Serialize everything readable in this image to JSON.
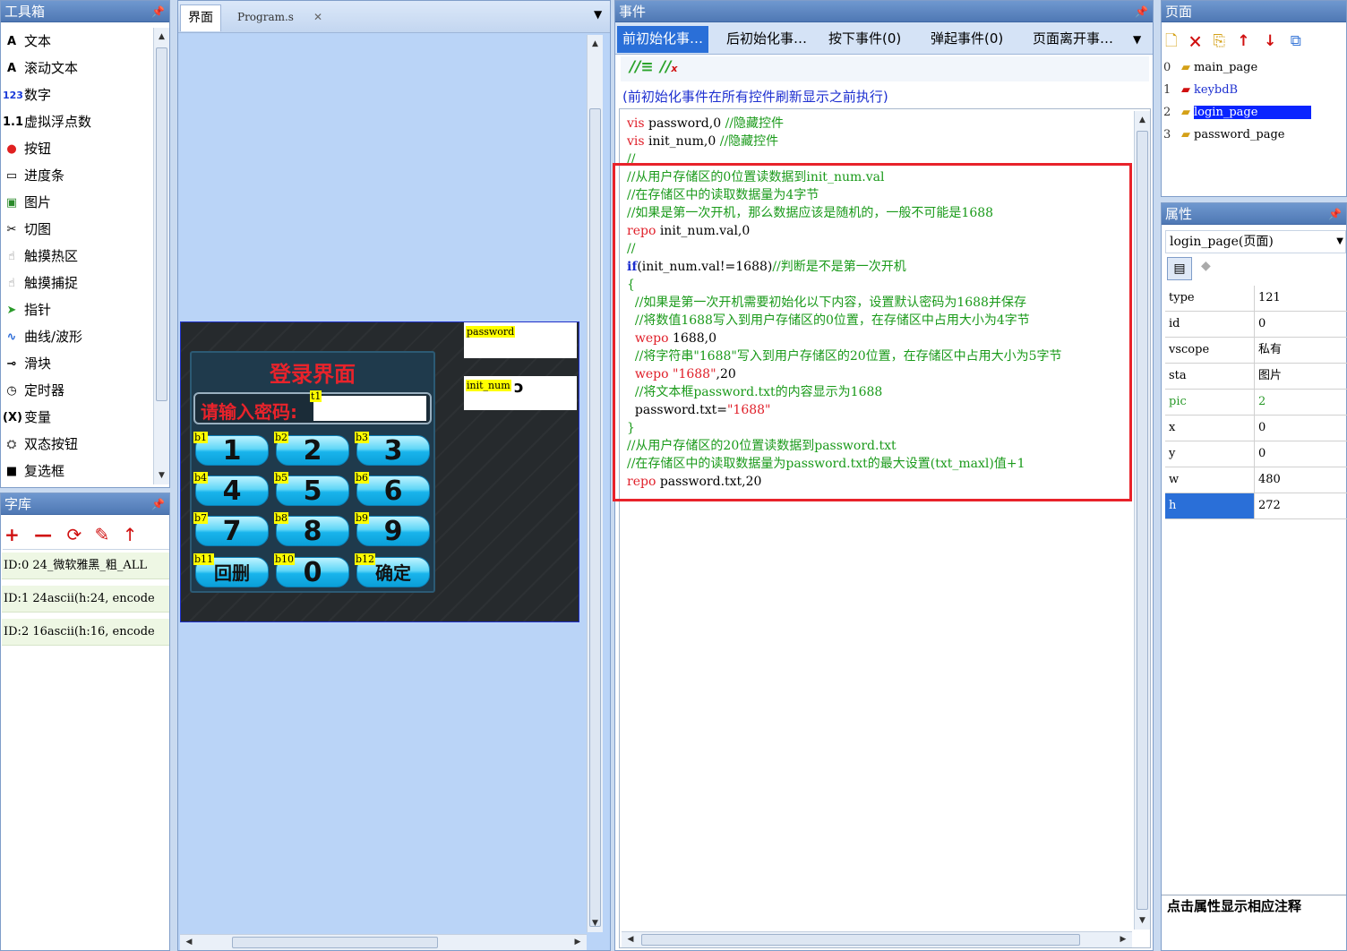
{
  "toolbox": {
    "title": "工具箱",
    "items": [
      {
        "label": "文本",
        "icon": "A"
      },
      {
        "label": "滚动文本",
        "icon": "A"
      },
      {
        "label": "数字",
        "icon": "123"
      },
      {
        "label": "虚拟浮点数",
        "icon": "1.1"
      },
      {
        "label": "按钮",
        "icon": "●"
      },
      {
        "label": "进度条",
        "icon": "▭"
      },
      {
        "label": "图片",
        "icon": "▣"
      },
      {
        "label": "切图",
        "icon": "✂"
      },
      {
        "label": "触摸热区",
        "icon": "☝"
      },
      {
        "label": "触摸捕捉",
        "icon": "☝"
      },
      {
        "label": "指针",
        "icon": "➤"
      },
      {
        "label": "曲线/波形",
        "icon": "∿"
      },
      {
        "label": "滑块",
        "icon": "⊸"
      },
      {
        "label": "定时器",
        "icon": "◷"
      },
      {
        "label": "变量",
        "icon": "(X)"
      },
      {
        "label": "双态按钮",
        "icon": "⛭"
      },
      {
        "label": "复选框",
        "icon": "■"
      }
    ]
  },
  "fontlib": {
    "title": "字库",
    "rows": [
      "ID:0   24_微软雅黑_粗_ALL",
      "ID:1   24ascii(h:24, encode",
      "ID:2   16ascii(h:16, encode"
    ]
  },
  "canvas": {
    "tabs": [
      "界面",
      "Program.s"
    ],
    "screen": {
      "title": "登录界面",
      "prompt": "请输入密码:",
      "tag_t1": "t1",
      "password_label": "password",
      "initnum_label": "init_num",
      "keys": [
        {
          "tag": "b1",
          "label": "1"
        },
        {
          "tag": "b2",
          "label": "2"
        },
        {
          "tag": "b3",
          "label": "3"
        },
        {
          "tag": "b4",
          "label": "4"
        },
        {
          "tag": "b5",
          "label": "5"
        },
        {
          "tag": "b6",
          "label": "6"
        },
        {
          "tag": "b7",
          "label": "7"
        },
        {
          "tag": "b8",
          "label": "8"
        },
        {
          "tag": "b9",
          "label": "9"
        },
        {
          "tag": "b11",
          "label": "回删"
        },
        {
          "tag": "b10",
          "label": "0"
        },
        {
          "tag": "b12",
          "label": "确定"
        }
      ]
    }
  },
  "events": {
    "title": "事件",
    "tabs": [
      "前初始化事…",
      "后初始化事…",
      "按下事件(0)",
      "弹起事件(0)",
      "页面离开事…"
    ],
    "description": "(前初始化事件在所有控件刷新显示之前执行)",
    "code": [
      [
        {
          "t": "kw",
          "s": "vis"
        },
        {
          "t": "n",
          "s": " password,0 "
        },
        {
          "t": "cm",
          "s": "//隐藏控件"
        }
      ],
      [
        {
          "t": "kw",
          "s": "vis"
        },
        {
          "t": "n",
          "s": " init_num,0 "
        },
        {
          "t": "cm",
          "s": "//隐藏控件"
        }
      ],
      [
        {
          "t": "cm",
          "s": "//"
        }
      ],
      [
        {
          "t": "cm",
          "s": "//从用户存储区的0位置读数据到init_num.val"
        }
      ],
      [
        {
          "t": "cm",
          "s": "//在存储区中的读取数据量为4字节"
        }
      ],
      [
        {
          "t": "cm",
          "s": "//如果是第一次开机，那么数据应该是随机的，一般不可能是1688"
        }
      ],
      [
        {
          "t": "kw",
          "s": "repo"
        },
        {
          "t": "n",
          "s": " init_num.val,0"
        }
      ],
      [
        {
          "t": "cm",
          "s": "//"
        }
      ],
      [
        {
          "t": "bl",
          "s": "if"
        },
        {
          "t": "n",
          "s": "(init_num.val!=1688)"
        },
        {
          "t": "cm",
          "s": "//判断是不是第一次开机"
        }
      ],
      [
        {
          "t": "cm",
          "s": "{"
        }
      ],
      [
        {
          "t": "cm",
          "s": "  //如果是第一次开机需要初始化以下内容，设置默认密码为1688并保存"
        }
      ],
      [
        {
          "t": "cm",
          "s": "  //将数值1688写入到用户存储区的0位置，在存储区中占用大小为4字节"
        }
      ],
      [
        {
          "t": "kw",
          "s": "  wepo"
        },
        {
          "t": "n",
          "s": " 1688,0"
        }
      ],
      [
        {
          "t": "cm",
          "s": "  //将字符串\"1688\"写入到用户存储区的20位置，在存储区中占用大小为5字节"
        }
      ],
      [
        {
          "t": "kw",
          "s": "  wepo"
        },
        {
          "t": "st",
          "s": " \"1688\""
        },
        {
          "t": "n",
          "s": ",20"
        }
      ],
      [
        {
          "t": "cm",
          "s": "  //将文本框password.txt的内容显示为1688"
        }
      ],
      [
        {
          "t": "n",
          "s": "  password.txt="
        },
        {
          "t": "st",
          "s": "\"1688\""
        }
      ],
      [
        {
          "t": "cm",
          "s": "}"
        }
      ],
      [
        {
          "t": "cm",
          "s": "//从用户存储区的20位置读数据到password.txt"
        }
      ],
      [
        {
          "t": "cm",
          "s": "//在存储区中的读取数据量为password.txt的最大设置(txt_maxl)值+1"
        }
      ],
      [
        {
          "t": "kw",
          "s": "repo"
        },
        {
          "t": "n",
          "s": " password.txt,20"
        }
      ]
    ]
  },
  "pages": {
    "title": "页面",
    "items": [
      {
        "index": "0",
        "name": "main_page"
      },
      {
        "index": "1",
        "name": "keybdB"
      },
      {
        "index": "2",
        "name": "login_page"
      },
      {
        "index": "3",
        "name": "password_page"
      }
    ],
    "selected_index": 2
  },
  "props": {
    "title": "属性",
    "selector": "login_page(页面)",
    "rows": [
      {
        "k": "type",
        "v": "121"
      },
      {
        "k": "id",
        "v": "0"
      },
      {
        "k": "vscope",
        "v": "私有"
      },
      {
        "k": "sta",
        "v": "图片"
      },
      {
        "k": "pic",
        "v": "2"
      },
      {
        "k": "x",
        "v": "0"
      },
      {
        "k": "y",
        "v": "0"
      },
      {
        "k": "w",
        "v": "480"
      },
      {
        "k": "h",
        "v": "272"
      }
    ],
    "hint": "点击属性显示相应注释"
  },
  "colors": {
    "accent": "#2a6fd8",
    "selection": "#0a24ff",
    "highlight_box": "#e8222a",
    "code_comment": "#1a9a1a",
    "code_keyword": "#e0202a"
  }
}
